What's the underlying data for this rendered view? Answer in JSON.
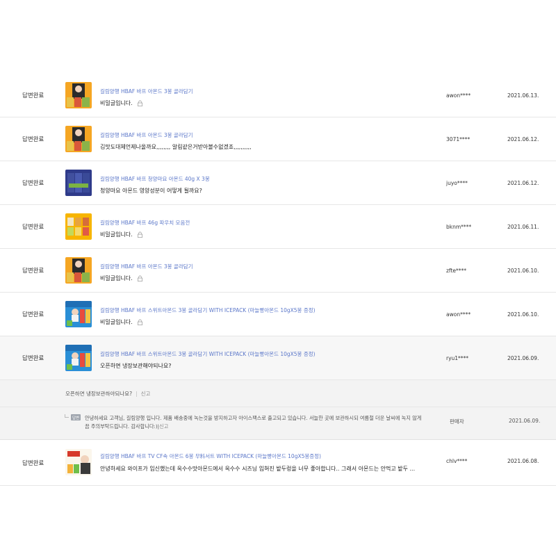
{
  "rows": [
    {
      "status": "답변완료",
      "title": "길림양행 HBAF 바프 아몬드 3봉 골라담기",
      "content": "비밀글입니다.",
      "locked": true,
      "user": "awon****",
      "date": "2021.06.13.",
      "thumb": "celebrity-orange"
    },
    {
      "status": "답변완료",
      "title": "길림양행 HBAF 바프 아몬드 3봉 골라담기",
      "content": "김맛도대체언제나올까요,,,,,,,, 알림같은거받아볼수없겠죠,,,,,,,,,,",
      "locked": false,
      "user": "3071****",
      "date": "2021.06.12.",
      "thumb": "celebrity-orange"
    },
    {
      "status": "답변완료",
      "title": "길림양행 HBAF 바프 청양마요 아몬드 40g X 3봉",
      "content": "청양마요 아몬드 영양성분이 어떻게 될까요?",
      "locked": false,
      "user": "juyo****",
      "date": "2021.06.12.",
      "thumb": "navy-packs"
    },
    {
      "status": "답변완료",
      "title": "길림양행 HBAF 바프 46g 파우치 모음전",
      "content": "비밀글입니다.",
      "locked": true,
      "user": "bknm****",
      "date": "2021.06.11.",
      "thumb": "yellow-packs"
    },
    {
      "status": "답변완료",
      "title": "길림양행 HBAF 바프 아몬드 3봉 골라담기",
      "content": "비밀글입니다.",
      "locked": true,
      "user": "zfte****",
      "date": "2021.06.10.",
      "thumb": "celebrity-orange"
    },
    {
      "status": "답변완료",
      "title": "길림양행 HBAF 바프 스위트아몬드 3봉 골라담기 WITH ICEPACK (마늘빵아몬드 10gX5봉 증정)",
      "content": "비밀글입니다.",
      "locked": true,
      "user": "awon****",
      "date": "2021.06.10.",
      "thumb": "celebrity-blue"
    },
    {
      "status": "답변완료",
      "title": "길림양행 HBAF 바프 스위트아몬드 3봉 골라담기 WITH ICEPACK (마늘빵아몬드 10gX5봉 증정)",
      "content": "오픈하면 냉장보관해야되나요?",
      "locked": false,
      "user": "ryu1****",
      "date": "2021.06.09.",
      "thumb": "celebrity-blue"
    }
  ],
  "expanded": {
    "question": "오픈하면 냉장보관하야되나요?",
    "report_label": "신고",
    "answer_badge": "답변",
    "answer_text": "안녕하세요 고객님, 길림양행 입니다. 제품 배송중에 녹는것을 방지하고자 아이스팩스로 출고되고 있습니다. 서늘한 곳에 보관하시되 여름철 더운 날씨에 녹지 않게끔 주의부탁드립니다. 감사합니다:)",
    "answer_report_label": "신고",
    "seller": "판매자",
    "answer_date": "2021.06.09."
  },
  "last_row": {
    "status": "답변완료",
    "title": "길림양행 HBAF 바프 TV CF속 아몬드 6봉 무料서트 WITH ICEPACK (마늘빵아몬드 10gX5봉증정)",
    "content": "안녕하세요 와이프가 임신했는데 옥수수맛아몬드에서 옥수수 시즈닝 입혀진 밭두렁을 너무 좋아합니다.. 그래서 아몬드는 안먹고 밭두 ...",
    "user": "chlv****",
    "date": "2021.06.08.",
    "thumb": "celebrity-white"
  },
  "colors": {
    "title_link": "#5b77c9",
    "badge_bg": "#9ea4ad",
    "open_row_bg": "#f7f7f7",
    "detail_bg": "#f3f3f3"
  }
}
